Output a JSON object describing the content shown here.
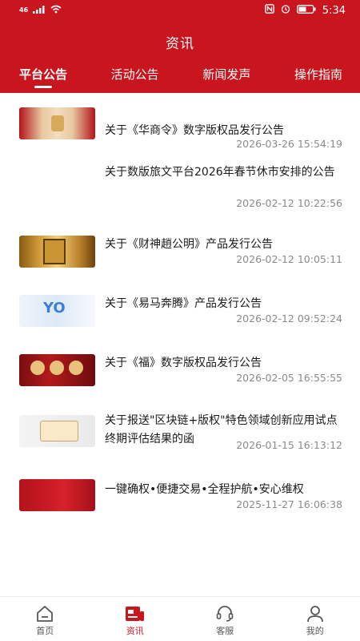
{
  "status_bar": {
    "network": "46",
    "time": "5:34"
  },
  "header": {
    "title": "资讯",
    "tabs": [
      {
        "label": "平台公告",
        "active": true
      },
      {
        "label": "活动公告",
        "active": false
      },
      {
        "label": "新闻发声",
        "active": false
      },
      {
        "label": "操作指南",
        "active": false
      }
    ]
  },
  "news": [
    {
      "title": "关于《华商令》数字版权品发行公告",
      "time": "2026-03-26 15:54:19",
      "thumb": "red-gold-banner"
    },
    {
      "title": "关于数版旅文平台2026年春节休市安排的公告",
      "time": "2026-02-12 10:22:56",
      "thumb": ""
    },
    {
      "title": "关于《财神趙公明》产品发行公告",
      "time": "2026-02-12 10:05:11",
      "thumb": "golden-deity"
    },
    {
      "title": "关于《易马奔腾》产品发行公告",
      "time": "2026-02-12 09:52:24",
      "thumb": "blue-horse"
    },
    {
      "title": "关于《福》数字版权品发行公告",
      "time": "2026-02-05 16:55:55",
      "thumb": "red-lanterns"
    },
    {
      "title": "关于报送\"区块链+版权\"特色领域创新应用试点终期评估结果的函",
      "time": "2026-01-15 16:13:12",
      "thumb": "blockchain-badge"
    },
    {
      "title": "一键确权•便捷交易•全程护航•安心维权",
      "time": "2025-11-27 16:06:38",
      "thumb": "red-platform-banner"
    }
  ],
  "bottom_nav": [
    {
      "label": "首页",
      "icon": "home-icon",
      "active": false
    },
    {
      "label": "资讯",
      "icon": "news-icon",
      "active": true
    },
    {
      "label": "客服",
      "icon": "headset-icon",
      "active": false
    },
    {
      "label": "我的",
      "icon": "user-icon",
      "active": false
    }
  ],
  "colors": {
    "brand_red": "#c9151e",
    "timestamp_gray": "#8a8a8a"
  }
}
